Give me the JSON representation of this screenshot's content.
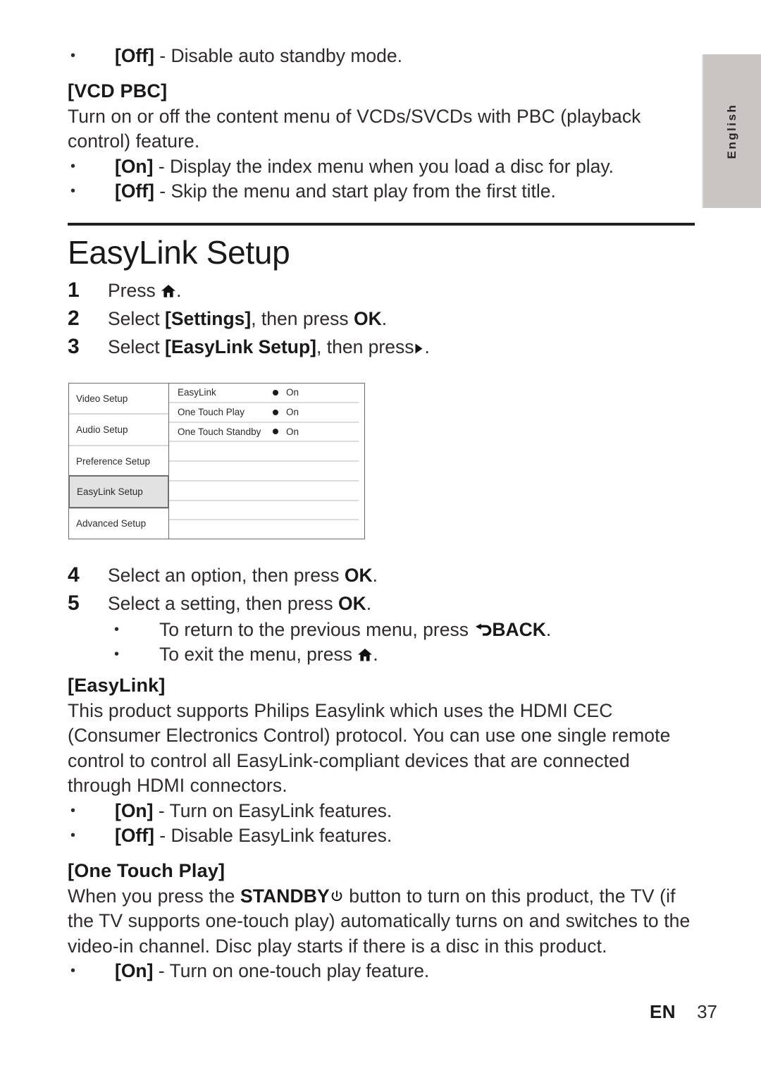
{
  "language_tab": {
    "label": "English"
  },
  "top_section": {
    "bullets_before": [
      {
        "option": "[Off]",
        "text": " - Disable auto standby mode."
      }
    ],
    "vcd_pbc": {
      "heading": "[VCD PBC]",
      "paragraph": "Turn on or off the content menu of VCDs/SVCDs with PBC (playback control) feature.",
      "bullets": [
        {
          "option": "[On]",
          "text": " - Display the index menu when you load a disc for play."
        },
        {
          "option": "[Off]",
          "text": " - Skip the menu and start play from the first title."
        }
      ]
    }
  },
  "section": {
    "title": "EasyLink Setup",
    "steps": [
      {
        "num": "1",
        "prefix": "Press ",
        "icon": "home-icon",
        "suffix": "."
      },
      {
        "num": "2",
        "prefix": "Select ",
        "bold": "[Settings]",
        "suffix": ", then press ",
        "bold2": "OK",
        "tail": "."
      },
      {
        "num": "3",
        "prefix": "Select ",
        "bold": "[EasyLink Setup]",
        "suffix": ", then press",
        "icon": "right-arrow-icon",
        "tail": "."
      },
      {
        "num": "4",
        "prefix": "Select an option, then press ",
        "bold2": "OK",
        "tail": "."
      },
      {
        "num": "5",
        "prefix": "Select a setting, then press ",
        "bold2": "OK",
        "tail": "."
      }
    ],
    "sub_bullets": [
      {
        "text_before": "To return to the previous menu, press ",
        "icon": "back-arrow-icon",
        "bold": "BACK",
        "text_after": "."
      },
      {
        "text_before": "To exit the menu, press ",
        "icon": "home-icon",
        "text_after": "."
      }
    ]
  },
  "menu_figure": {
    "left_items": [
      {
        "label": "Video Setup",
        "selected": false
      },
      {
        "label": "Audio Setup",
        "selected": false
      },
      {
        "label": "Preference Setup",
        "selected": false
      },
      {
        "label": "EasyLink Setup",
        "selected": true
      },
      {
        "label": "Advanced Setup",
        "selected": false
      }
    ],
    "right_rows": [
      {
        "label": "EasyLink",
        "value": "On",
        "has_dot": true
      },
      {
        "label": "One Touch Play",
        "value": "On",
        "has_dot": true
      },
      {
        "label": "One Touch Standby",
        "value": "On",
        "has_dot": true
      },
      {
        "label": "",
        "value": "",
        "has_dot": false
      },
      {
        "label": "",
        "value": "",
        "has_dot": false
      },
      {
        "label": "",
        "value": "",
        "has_dot": false
      },
      {
        "label": "",
        "value": "",
        "has_dot": false
      },
      {
        "label": "",
        "value": "",
        "has_dot": false
      }
    ]
  },
  "easylink_section": {
    "heading": "[EasyLink]",
    "paragraph": "This product supports Philips Easylink which uses the HDMI CEC (Consumer Electronics Control) protocol. You can use one single remote control to control all EasyLink-compliant devices that are connected through HDMI connectors.",
    "bullets": [
      {
        "option": "[On]",
        "text": " - Turn on EasyLink features."
      },
      {
        "option": "[Off]",
        "text": " - Disable EasyLink features."
      }
    ]
  },
  "one_touch_play_section": {
    "heading": "[One Touch Play]",
    "paragraph_part1": "When you press the ",
    "paragraph_bold": "STANDBY",
    "paragraph_icon": "power-icon",
    "paragraph_part2": " button to turn on this product, the TV (if the TV supports one-touch play) automatically turns on and switches to the video-in channel. Disc play starts if there is a disc in this product.",
    "bullets": [
      {
        "option": "[On]",
        "text": " - Turn on one-touch play feature."
      }
    ]
  },
  "footer": {
    "language_code": "EN",
    "page_number": "37"
  }
}
